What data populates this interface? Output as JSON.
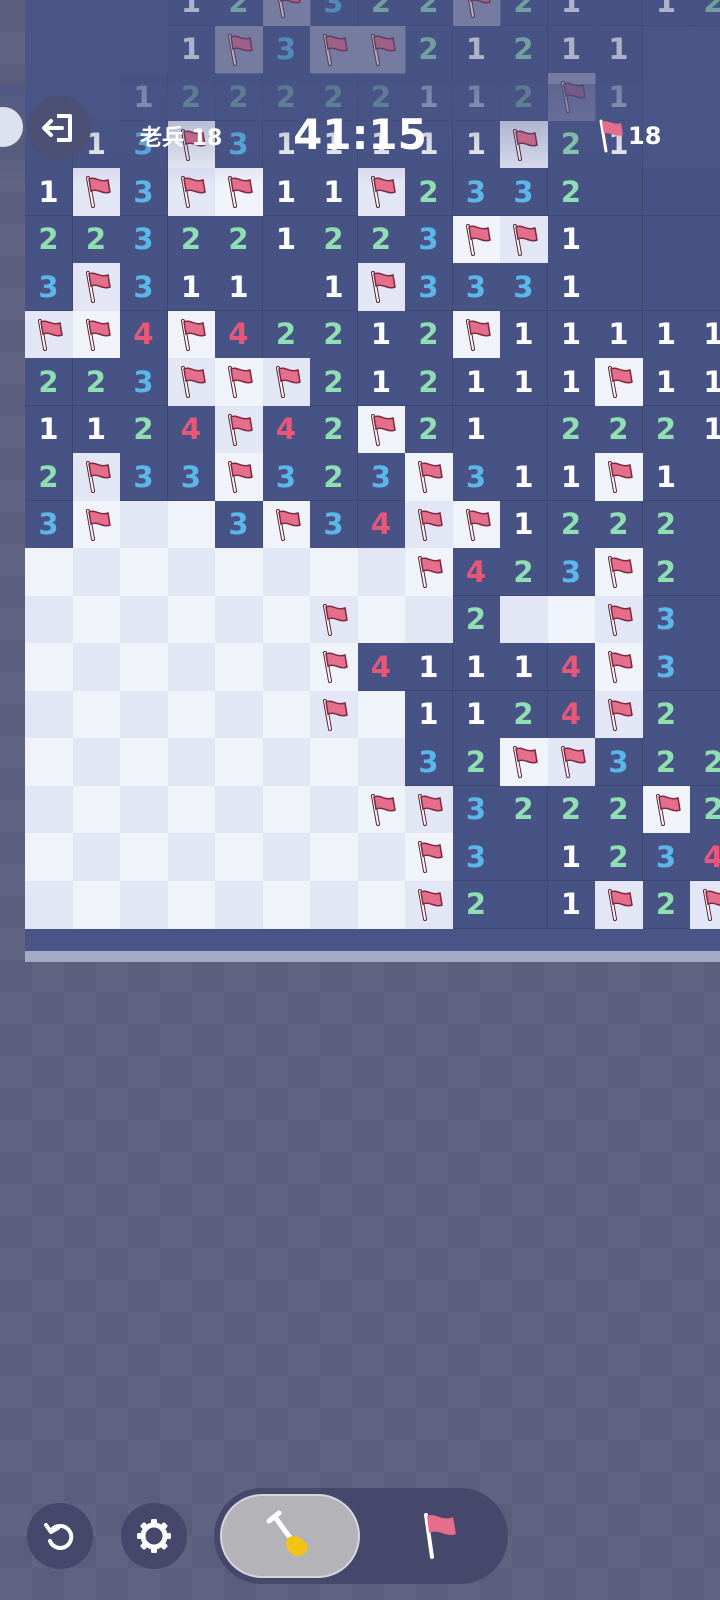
{
  "hud": {
    "difficulty_label": "老兵 18",
    "timer": "41:15",
    "flags_remaining": "18"
  },
  "icons": {
    "exit": "exit-icon",
    "flag": "flag-icon",
    "undo": "undo-icon",
    "settings": "gear-icon",
    "dig": "shovel-icon"
  },
  "colors": {
    "revealed_cell": "#485385",
    "hidden_cell_light": "#f1f3fb",
    "hidden_cell_dark": "#e3e6f5",
    "flag": "#e46e8b",
    "number_1": "#ffffff",
    "number_2": "#8fdfb3",
    "number_3": "#5bb7ea",
    "number_4": "#e6577a",
    "background": "#5a5d7c"
  },
  "toolbar": {
    "active_mode": "dig"
  },
  "board": {
    "legend": "digit = revealed number, F = flag, '.' = revealed empty, '#' = unrevealed, '-' = not visible in screenshot",
    "rows": [
      [
        "-",
        "-",
        "-",
        "1",
        "2",
        "F",
        "3",
        "2",
        "2",
        "F",
        "2",
        "1",
        ".",
        "1",
        "2"
      ],
      [
        "-",
        "-",
        "-",
        "1",
        "F",
        "3",
        "F",
        "F",
        "2",
        "1",
        "2",
        "1",
        "1",
        "-",
        "-"
      ],
      [
        "-",
        "-",
        "1",
        "2",
        "2",
        "2",
        "2",
        "2",
        "1",
        "1",
        "2",
        "F",
        "1",
        "-",
        "-"
      ],
      [
        "1",
        "1",
        "3",
        "F",
        "3",
        "1",
        "1",
        "1",
        "1",
        "1",
        "F",
        "2",
        "1",
        "-",
        "-"
      ],
      [
        "1",
        "F",
        "3",
        "F",
        "F",
        "1",
        "1",
        "F",
        "2",
        "3",
        "3",
        "2",
        ".",
        ".",
        "."
      ],
      [
        "2",
        "2",
        "3",
        "2",
        "2",
        "1",
        "2",
        "2",
        "3",
        "F",
        "F",
        "1",
        ".",
        ".",
        "."
      ],
      [
        "3",
        "F",
        "3",
        "1",
        "1",
        ".",
        "1",
        "F",
        "3",
        "3",
        "3",
        "1",
        ".",
        ".",
        "."
      ],
      [
        "F",
        "F",
        "4",
        "F",
        "4",
        "2",
        "2",
        "1",
        "2",
        "F",
        "1",
        "1",
        "1",
        "1",
        "1"
      ],
      [
        "2",
        "2",
        "3",
        "F",
        "F",
        "F",
        "2",
        "1",
        "2",
        "1",
        "1",
        "1",
        "F",
        "1",
        "1"
      ],
      [
        "1",
        "1",
        "2",
        "4",
        "F",
        "4",
        "2",
        "F",
        "2",
        "1",
        ".",
        "2",
        "2",
        "2",
        "1"
      ],
      [
        "2",
        "F",
        "3",
        "3",
        "F",
        "3",
        "2",
        "3",
        "F",
        "3",
        "1",
        "1",
        "F",
        "1",
        "."
      ],
      [
        "3",
        "F",
        "#",
        "#",
        "3",
        "F",
        "3",
        "4",
        "F",
        "F",
        "1",
        "2",
        "2",
        "2",
        "."
      ],
      [
        "#",
        "#",
        "#",
        "#",
        "#",
        "#",
        "#",
        "#",
        "F",
        "4",
        "2",
        "3",
        "F",
        "2",
        "."
      ],
      [
        "#",
        "#",
        "#",
        "#",
        "#",
        "#",
        "F",
        "#",
        "#",
        "2",
        "#",
        "#",
        "F",
        "3",
        "."
      ],
      [
        "#",
        "#",
        "#",
        "#",
        "#",
        "#",
        "F",
        "4",
        "1",
        "1",
        "1",
        "4",
        "F",
        "3",
        "."
      ],
      [
        "#",
        "#",
        "#",
        "#",
        "#",
        "#",
        "F",
        "#",
        "1",
        "1",
        "2",
        "4",
        "F",
        "2",
        "."
      ],
      [
        "#",
        "#",
        "#",
        "#",
        "#",
        "#",
        "#",
        "#",
        "3",
        "2",
        "F",
        "F",
        "3",
        "2",
        "2"
      ],
      [
        "#",
        "#",
        "#",
        "#",
        "#",
        "#",
        "#",
        "F",
        "F",
        "3",
        "2",
        "2",
        "2",
        "F",
        "2"
      ],
      [
        "#",
        "#",
        "#",
        "#",
        "#",
        "#",
        "#",
        "#",
        "F",
        "3",
        ".",
        "1",
        "2",
        "3",
        "4"
      ],
      [
        "#",
        "#",
        "#",
        "#",
        "#",
        "#",
        "#",
        "#",
        "F",
        "2",
        ".",
        "1",
        "F",
        "2",
        "F"
      ]
    ]
  }
}
